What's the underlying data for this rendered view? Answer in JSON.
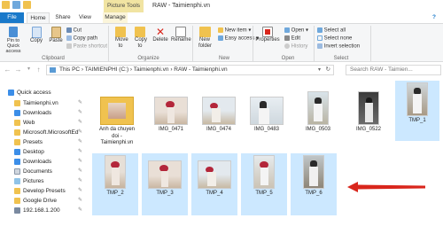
{
  "window": {
    "picture_tools": "Picture Tools",
    "title": "RAW - Taimienphi.vn"
  },
  "tabs": {
    "file": "File",
    "home": "Home",
    "share": "Share",
    "view": "View",
    "manage": "Manage"
  },
  "ribbon": {
    "clipboard": {
      "pin": "Pin to Quick access",
      "copy": "Copy",
      "paste": "Paste",
      "cut": "Cut",
      "copy_path": "Copy path",
      "paste_shortcut": "Paste shortcut",
      "label": "Clipboard"
    },
    "organize": {
      "move_to": "Move to",
      "copy_to": "Copy to",
      "delete": "Delete",
      "rename": "Rename",
      "label": "Organize"
    },
    "new": {
      "new_folder": "New folder",
      "new_item": "New item",
      "easy_access": "Easy access",
      "label": "New"
    },
    "open": {
      "properties": "Properties",
      "open": "Open",
      "edit": "Edit",
      "history": "History",
      "label": "Open"
    },
    "select": {
      "select_all": "Select all",
      "select_none": "Select none",
      "invert_selection": "Invert selection",
      "label": "Select"
    }
  },
  "address": {
    "path": "This PC  ›  TAIMIENPHI (C:)  ›  Taimienphi.vn  ›  RAW - Taimienphi.vn",
    "search_placeholder": "Search RAW - Taimien..."
  },
  "sidebar": {
    "quick_access": "Quick access",
    "items": [
      {
        "label": "Taimienphi.vn",
        "pinned": true
      },
      {
        "label": "Downloads",
        "pinned": true
      },
      {
        "label": "Web",
        "pinned": true
      },
      {
        "label": "Microsoft.MicrosoftEd",
        "pinned": true
      },
      {
        "label": "Presets",
        "pinned": true
      },
      {
        "label": "Desktop",
        "pinned": true
      },
      {
        "label": "Downloads",
        "pinned": true
      },
      {
        "label": "Documents",
        "pinned": true
      },
      {
        "label": "Pictures",
        "pinned": true
      },
      {
        "label": "Develop Presets",
        "pinned": true
      },
      {
        "label": "Google Drive",
        "pinned": true
      },
      {
        "label": "192.168.1.200",
        "pinned": true
      }
    ]
  },
  "files": [
    {
      "name": "Anh da chuyen doi - Taimienphi.vn",
      "selected": false
    },
    {
      "name": "IMG_0471",
      "selected": false
    },
    {
      "name": "IMG_0474",
      "selected": false
    },
    {
      "name": "IMG_0483",
      "selected": false
    },
    {
      "name": "IMG_0503",
      "selected": false
    },
    {
      "name": "IMG_0522",
      "selected": false
    },
    {
      "name": "TMP_1",
      "selected": true
    },
    {
      "name": "TMP_2",
      "selected": true
    },
    {
      "name": "TMP_3",
      "selected": true
    },
    {
      "name": "TMP_4",
      "selected": true
    },
    {
      "name": "TMP_5",
      "selected": true
    },
    {
      "name": "TMP_6",
      "selected": true
    }
  ],
  "colors": {
    "file_tab": "#1979ca",
    "selection": "#cce8ff",
    "manage_tab": "#f1e4a2",
    "folder": "#f0c24f",
    "arrow": "#d9261c"
  }
}
